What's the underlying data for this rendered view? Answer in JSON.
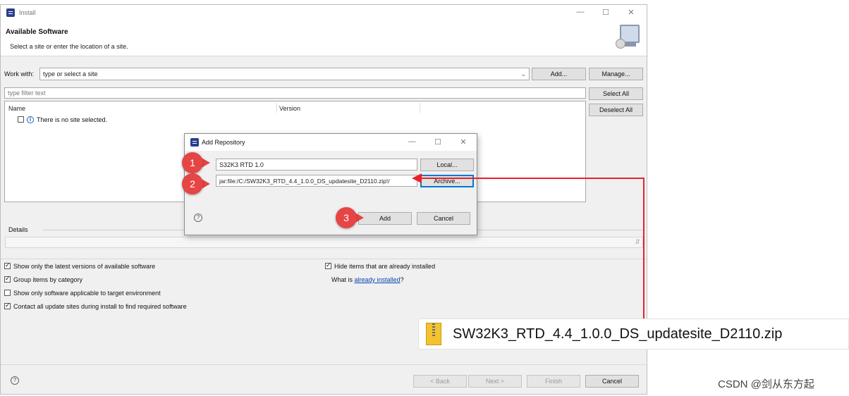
{
  "window": {
    "title": "Install",
    "controls": {
      "minimize": "—",
      "maximize": "☐",
      "close": "✕"
    }
  },
  "header": {
    "title": "Available Software",
    "subtitle": "Select a site or enter the location of a site."
  },
  "work_with": {
    "label": "Work with:",
    "value": "type or select a site",
    "add_button": "Add...",
    "manage_button": "Manage..."
  },
  "filter": {
    "placeholder": "type filter text",
    "select_all": "Select All",
    "deselect_all": "Deselect All"
  },
  "table": {
    "columns": [
      "Name",
      "Version"
    ],
    "rows": [
      {
        "text": "There is no site selected."
      }
    ]
  },
  "details": {
    "label": "Details"
  },
  "options": {
    "left": [
      {
        "label": "Show only the latest versions of available software",
        "checked": true
      },
      {
        "label": "Group items by category",
        "checked": true
      },
      {
        "label": "Show only software applicable to target environment",
        "checked": false
      },
      {
        "label": "Contact all update sites during install to find required software",
        "checked": true
      }
    ],
    "right": [
      {
        "label": "Hide items that are already installed",
        "checked": true
      }
    ],
    "what_is_prefix": "What is ",
    "what_is_link": "already installed",
    "what_is_suffix": "?"
  },
  "footer": {
    "help": "?",
    "back": "< Back",
    "next": "Next >",
    "finish": "Finish",
    "cancel": "Cancel"
  },
  "dialog": {
    "title": "Add Repository",
    "controls": {
      "minimize": "—",
      "maximize": "☐",
      "close": "✕"
    },
    "name_value": "S32K3 RTD 1.0",
    "location_value": "jar:file:/C:/SW32K3_RTD_4.4_1.0.0_DS_updatesite_D2110.zip!/",
    "local_button": "Local...",
    "archive_button": "Archive...",
    "help": "?",
    "add_button": "Add",
    "cancel_button": "Cancel"
  },
  "annotations": {
    "badges": [
      "1",
      "2",
      "3"
    ],
    "badge_color": "#e64545",
    "arrow_color": "#e8212b"
  },
  "zip_file": {
    "name": "SW32K3_RTD_4.4_1.0.0_DS_updatesite_D2110.zip"
  },
  "watermark": "CSDN @剑从东方起"
}
